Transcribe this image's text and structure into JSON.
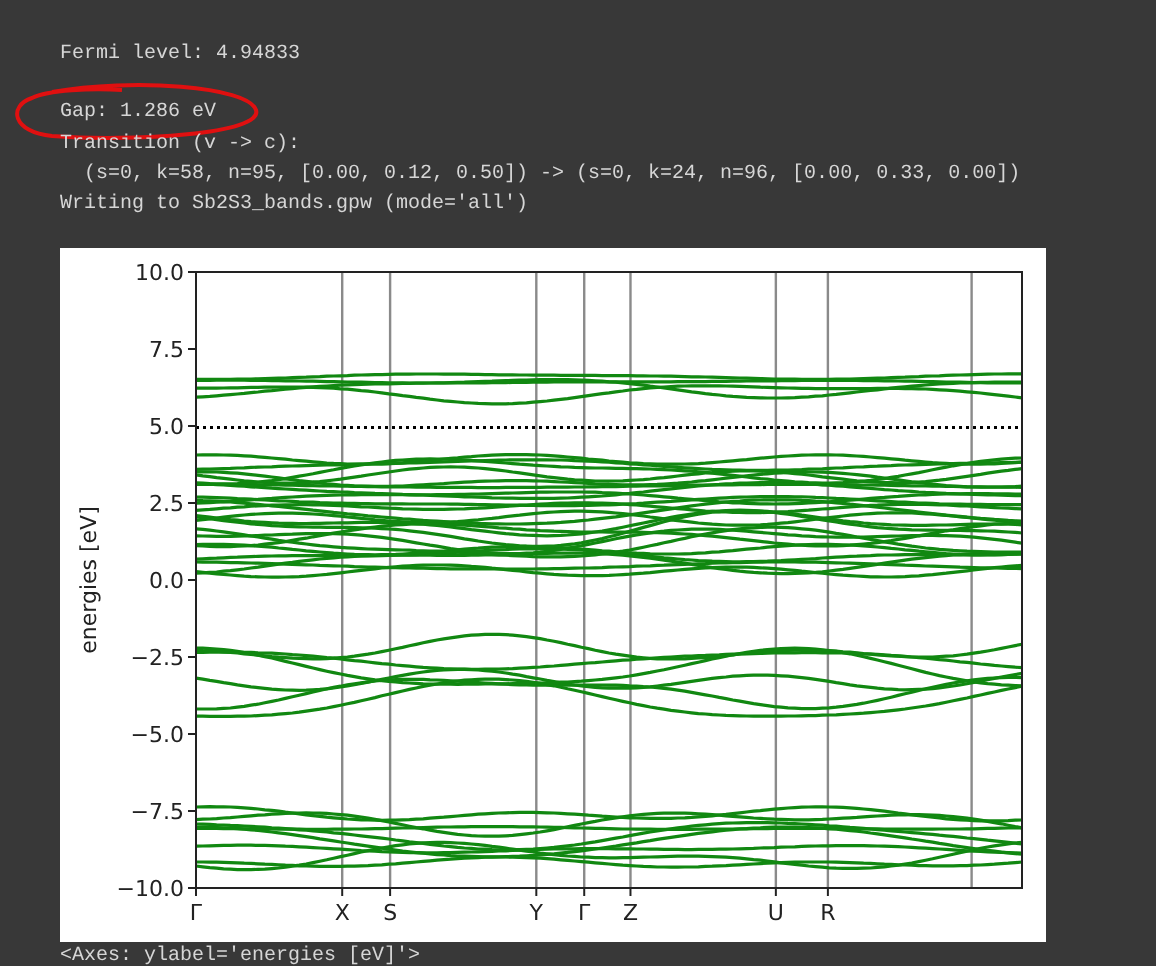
{
  "output_lines": [
    {
      "text": "Fermi level: 4.94833",
      "gap_before": false,
      "circled": false
    },
    {
      "text": "Gap: 1.286 eV",
      "gap_before": true,
      "circled": true
    },
    {
      "text": "Transition (v -> c):",
      "gap_before": false,
      "circled": false
    },
    {
      "text": "  (s=0, k=58, n=95, [0.00, 0.12, 0.50]) -> (s=0, k=24, n=96, [0.00, 0.33, 0.00])",
      "gap_before": false,
      "circled": false
    },
    {
      "text": "Writing to Sb2S3_bands.gpw (mode='all')",
      "gap_before": false,
      "circled": false
    }
  ],
  "plot": {
    "ylabel": "energies [eV]",
    "yticks": [
      "10.0",
      "7.5",
      "5.0",
      "2.5",
      "0.0",
      "−2.5",
      "−5.0",
      "−7.5",
      "−10.0"
    ],
    "kpoints": [
      "Γ",
      "X",
      "S",
      "Y",
      "Γ",
      "Z",
      "U",
      "R"
    ]
  },
  "result_repr": "<Axes: ylabel='energies [eV]'>"
}
